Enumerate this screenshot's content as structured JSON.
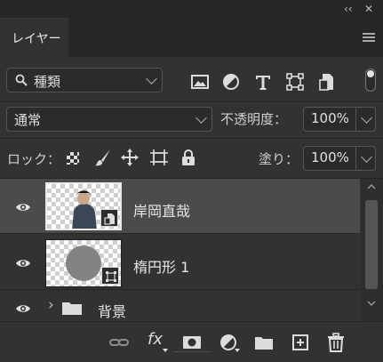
{
  "window": {
    "collapse_glyph": "‹‹",
    "close_glyph": "✕"
  },
  "panel": {
    "tab_label": "レイヤー"
  },
  "filter": {
    "kind_label": "種類",
    "icons": [
      "image-filter-icon",
      "adjustment-filter-icon",
      "type-filter-icon",
      "shape-filter-icon",
      "smart-object-filter-icon"
    ]
  },
  "blend": {
    "mode": "通常",
    "opacity_label": "不透明度：",
    "opacity_value": "100%"
  },
  "lock": {
    "label": "ロック：",
    "fill_label": "塗り：",
    "fill_value": "100%",
    "icons": [
      "lock-transparent-pixels-icon",
      "lock-image-pixels-icon",
      "lock-position-icon",
      "lock-artboard-icon",
      "lock-all-icon"
    ]
  },
  "layers": [
    {
      "name": "岸岡直哉",
      "type": "smart-object",
      "visible": true,
      "selected": true
    },
    {
      "name": "楕円形 1",
      "type": "shape",
      "visible": true,
      "selected": false
    },
    {
      "name": "背景",
      "type": "group",
      "visible": true,
      "selected": false,
      "expand_glyph": "›"
    }
  ],
  "bottom_toolbar": {
    "fx_label": "fx",
    "icons": [
      "link-layers-icon",
      "fx-icon",
      "add-mask-icon",
      "new-adjustment-layer-icon",
      "new-group-icon",
      "new-layer-icon",
      "delete-layer-icon"
    ]
  },
  "colors": {
    "panel_bg": "#323232",
    "selected_row": "#4b4b4b",
    "header_bg": "#262626"
  }
}
